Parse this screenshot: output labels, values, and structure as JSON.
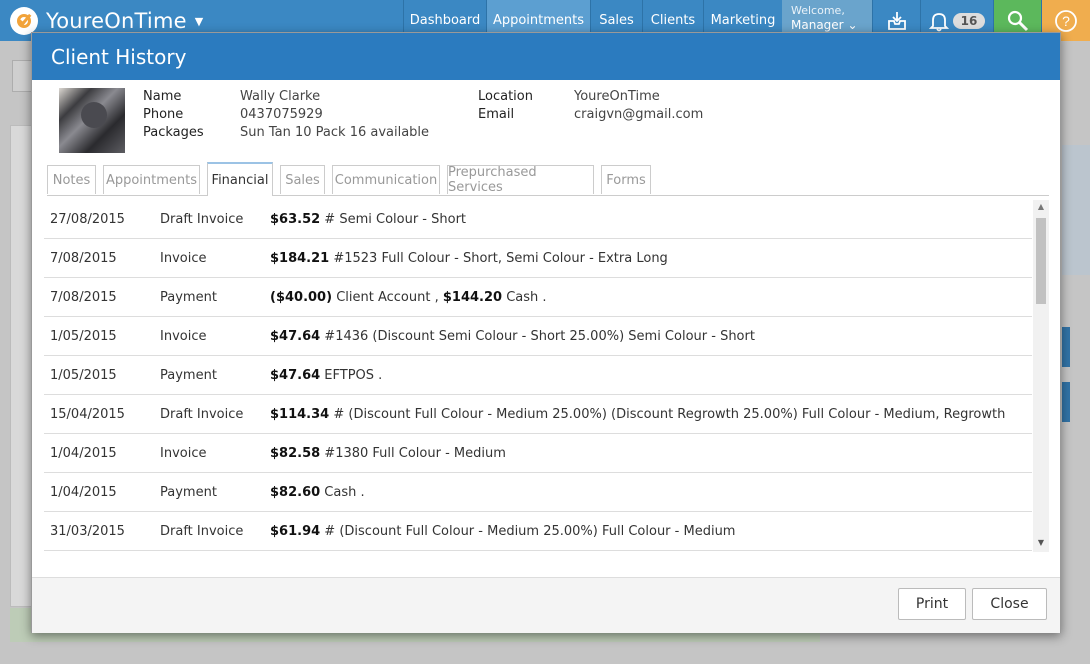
{
  "app": {
    "name": "YoureOnTime"
  },
  "nav": [
    {
      "label": "Dashboard",
      "active": false
    },
    {
      "label": "Appointments",
      "active": true
    },
    {
      "label": "Sales",
      "active": false
    },
    {
      "label": "Clients",
      "active": false
    },
    {
      "label": "Marketing",
      "active": false
    }
  ],
  "welcome": {
    "line1": "Welcome,",
    "line2": "Manager"
  },
  "notifications": {
    "count": "16"
  },
  "icons": {
    "inbox": "inbox-icon",
    "bell": "bell-icon",
    "search": "search-icon",
    "help": "help-icon"
  },
  "colors": {
    "header_blue": "#3b88c3",
    "modal_blue": "#2b7bbf",
    "search_green": "#5cb85c",
    "help_orange": "#f0ad4e"
  },
  "modal": {
    "title": "Client History",
    "client": {
      "name_label": "Name",
      "name": "Wally Clarke",
      "phone_label": "Phone",
      "phone": "0437075929",
      "packages_label": "Packages",
      "packages": "Sun Tan 10 Pack 16 available",
      "location_label": "Location",
      "location": "YoureOnTime",
      "email_label": "Email",
      "email": "craigvn@gmail.com"
    },
    "tabs": [
      {
        "label": "Notes",
        "active": false
      },
      {
        "label": "Appointments",
        "active": false
      },
      {
        "label": "Financial",
        "active": true
      },
      {
        "label": "Sales",
        "active": false
      },
      {
        "label": "Communication",
        "active": false
      },
      {
        "label": "Prepurchased Services",
        "active": false
      },
      {
        "label": "Forms",
        "active": false
      }
    ],
    "financial": [
      {
        "date": "27/08/2015",
        "type": "Draft Invoice",
        "amount": "$63.52",
        "detail": " # Semi Colour - Short"
      },
      {
        "date": "7/08/2015",
        "type": "Invoice",
        "amount": "$184.21",
        "detail": " #1523 Full Colour - Short, Semi Colour - Extra Long"
      },
      {
        "date": "7/08/2015",
        "type": "Payment",
        "amount": "($40.00)",
        "detail": " Client Account , ",
        "amount2": "$144.20",
        "detail2": " Cash ."
      },
      {
        "date": "1/05/2015",
        "type": "Invoice",
        "amount": "$47.64",
        "detail": " #1436 (Discount Semi Colour - Short 25.00%) Semi Colour - Short"
      },
      {
        "date": "1/05/2015",
        "type": "Payment",
        "amount": "$47.64",
        "detail": " EFTPOS ."
      },
      {
        "date": "15/04/2015",
        "type": "Draft Invoice",
        "amount": "$114.34",
        "detail": " # (Discount Full Colour - Medium 25.00%) (Discount Regrowth 25.00%) Full Colour - Medium, Regrowth"
      },
      {
        "date": "1/04/2015",
        "type": "Invoice",
        "amount": "$82.58",
        "detail": " #1380 Full Colour - Medium"
      },
      {
        "date": "1/04/2015",
        "type": "Payment",
        "amount": "$82.60",
        "detail": " Cash ."
      },
      {
        "date": "31/03/2015",
        "type": "Draft Invoice",
        "amount": "$61.94",
        "detail": " # (Discount Full Colour - Medium 25.00%) Full Colour - Medium"
      }
    ],
    "buttons": {
      "print": "Print",
      "close": "Close"
    }
  }
}
